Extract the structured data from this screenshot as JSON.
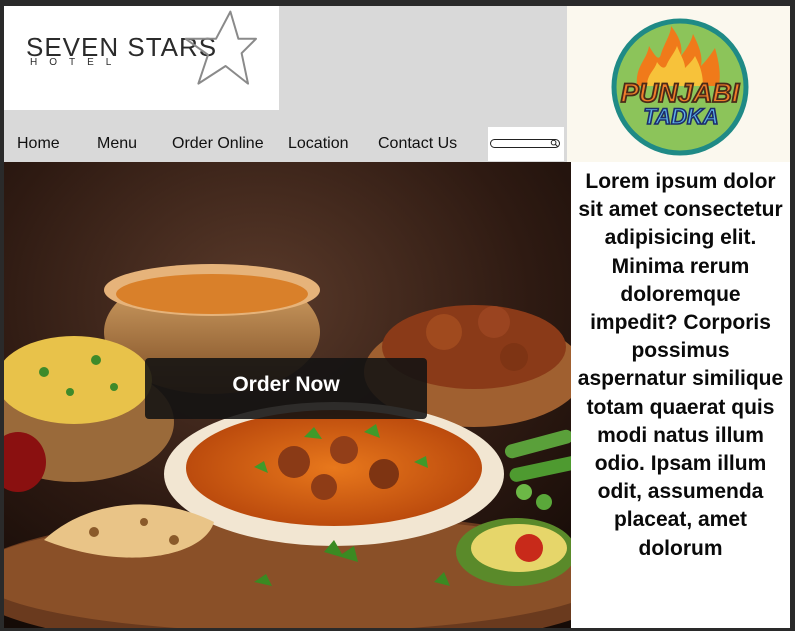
{
  "hotel_logo": {
    "name": "SEVEN STARS",
    "subtitle": "HOTEL"
  },
  "brand_logo": {
    "line1": "PUNJABI",
    "line2": "TADKA"
  },
  "nav": {
    "items": [
      {
        "label": "Home"
      },
      {
        "label": "Menu"
      },
      {
        "label": "Order Online"
      },
      {
        "label": "Location"
      },
      {
        "label": "Contact Us"
      }
    ],
    "search_value": ""
  },
  "hero": {
    "cta_label": "Order Now"
  },
  "side_text": "Lorem ipsum dolor sit amet consectetur adipisicing elit. Minima rerum doloremque impedit? Corporis possimus aspernatur similique totam quaerat quis modi natus illum odio. Ipsam illum odit, assumenda placeat, amet dolorum"
}
